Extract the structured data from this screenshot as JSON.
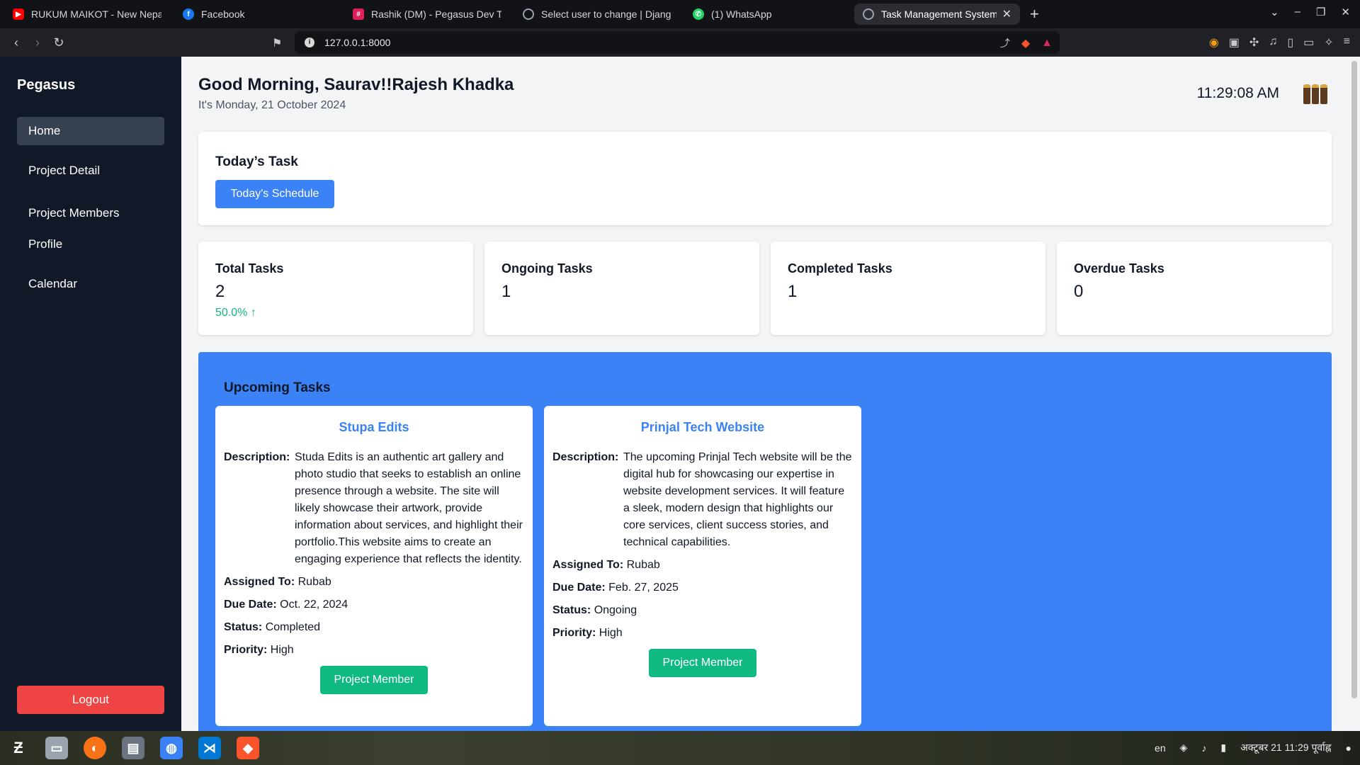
{
  "browser": {
    "tabs": [
      {
        "title": "RUKUM MAIKOT - New Nepali",
        "icon": "youtube-icon",
        "color": "#ff0000"
      },
      {
        "title": "Facebook",
        "icon": "facebook-icon",
        "color": "#1877f2"
      },
      {
        "title": "Rashik (DM) - Pegasus Dev Te",
        "icon": "slack-icon",
        "color": "#e01e5a"
      },
      {
        "title": "Select user to change | Django",
        "icon": "globe-icon",
        "color": "#9ca3af"
      },
      {
        "title": "(1) WhatsApp",
        "icon": "whatsapp-icon",
        "color": "#25d366"
      },
      {
        "title": "Task Management System",
        "icon": "globe-icon",
        "color": "#9ca3af"
      }
    ],
    "url": "127.0.0.1:8000"
  },
  "sidebar": {
    "brand": "Pegasus",
    "items": [
      {
        "label": "Home",
        "active": true
      },
      {
        "label": "Project Detail",
        "active": false
      },
      {
        "label": "Project Members",
        "active": false
      },
      {
        "label": "Profile",
        "active": false
      },
      {
        "label": "Calendar",
        "active": false
      }
    ],
    "logout": "Logout"
  },
  "header": {
    "greeting": "Good Morning, Saurav!!Rajesh Khadka",
    "date": "It's Monday, 21 October 2024",
    "time": "11:29:08 AM"
  },
  "today": {
    "title": "Today’s Task",
    "button": "Today's Schedule"
  },
  "stats": [
    {
      "label": "Total Tasks",
      "value": "2",
      "extra": "50.0% ↑"
    },
    {
      "label": "Ongoing Tasks",
      "value": "1",
      "extra": ""
    },
    {
      "label": "Completed Tasks",
      "value": "1",
      "extra": ""
    },
    {
      "label": "Overdue Tasks",
      "value": "0",
      "extra": ""
    }
  ],
  "upcoming": {
    "title": "Upcoming Tasks",
    "labels": {
      "description": "Description:",
      "assigned": "Assigned To:",
      "due": "Due Date:",
      "status": "Status:",
      "priority": "Priority:"
    },
    "tasks": [
      {
        "name": "Stupa Edits",
        "description": "Studa Edits is an authentic art gallery and photo studio that seeks to establish an online presence through a website. The site will likely showcase their artwork, provide information about services, and highlight their portfolio.This website aims to create an engaging experience that reflects the identity.",
        "assigned": "Rubab",
        "due": "Oct. 22, 2024",
        "status": "Completed",
        "priority": "High",
        "button": "Project Member"
      },
      {
        "name": "Prinjal Tech Website",
        "description": "The upcoming Prinjal Tech website will be the digital hub for showcasing our expertise in website development services. It will feature a sleek, modern design that highlights our core services, client success stories, and technical capabilities.",
        "assigned": "Rubab",
        "due": "Feb. 27, 2025",
        "status": "Ongoing",
        "priority": "High",
        "button": "Project Member"
      }
    ]
  },
  "taskbar": {
    "lang": "en",
    "clock": "अक्टूबर 21  11:29 पूर्वाह्न"
  },
  "colors": {
    "sidebar": "#111827",
    "accent": "#3b82f6",
    "success": "#10b981",
    "danger": "#ef4444"
  }
}
